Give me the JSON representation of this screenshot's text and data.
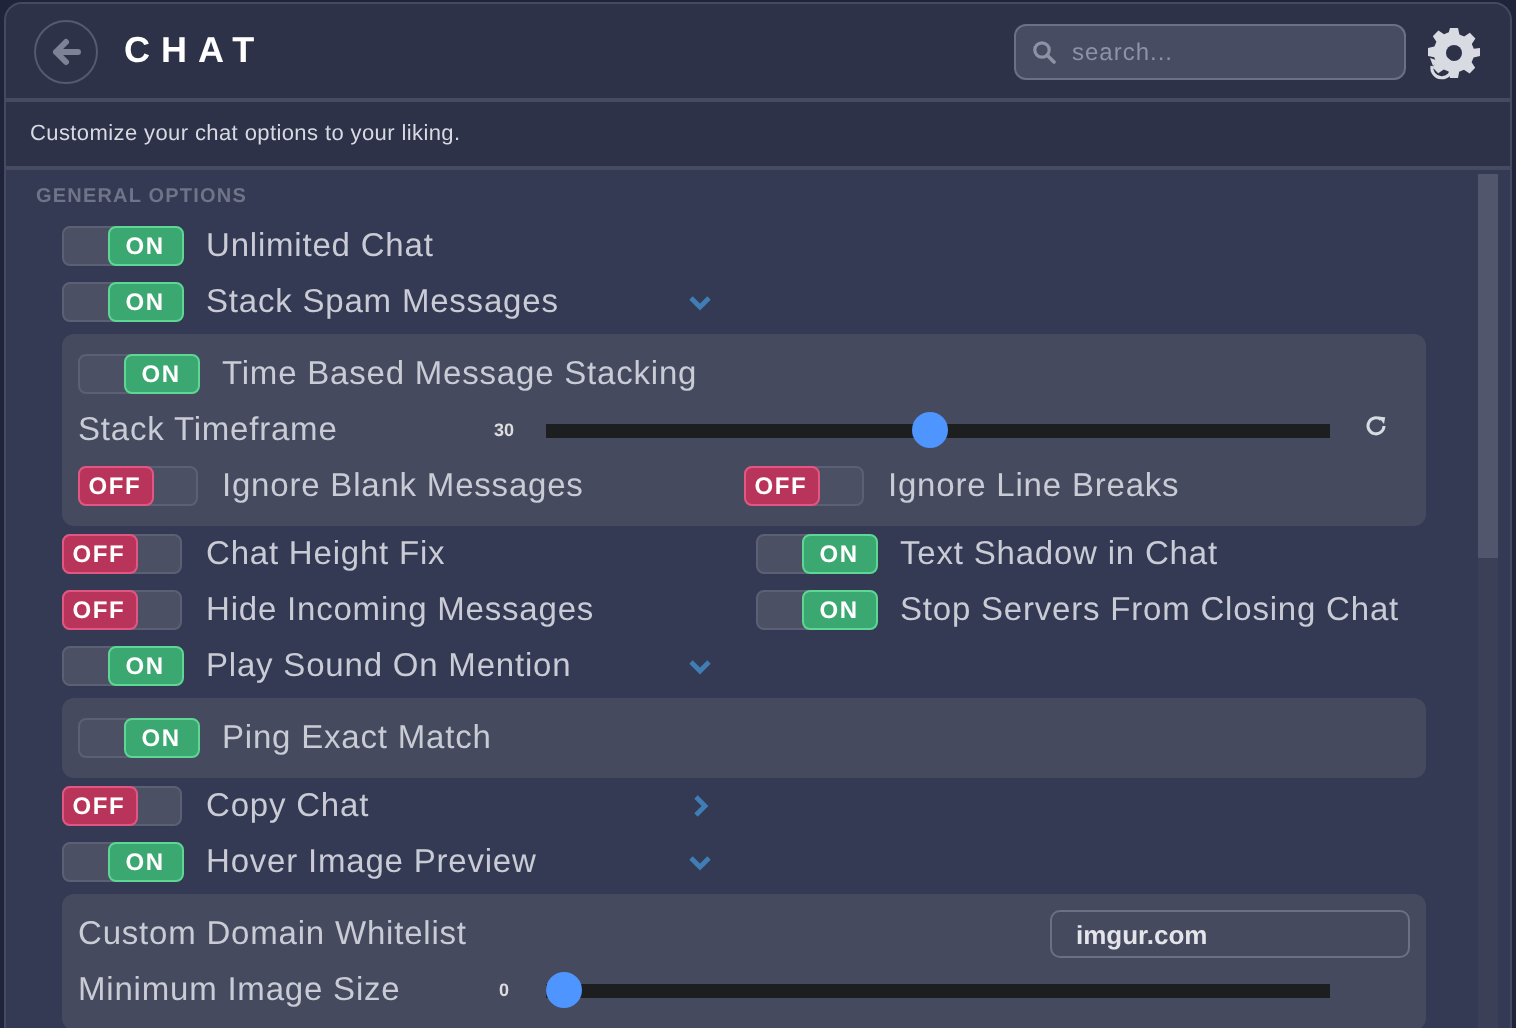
{
  "header": {
    "title": "CHAT",
    "search": {
      "placeholder": "search..."
    }
  },
  "subtitle": "Customize your chat options to your liking.",
  "section": {
    "title": "GENERAL OPTIONS",
    "items": [
      {
        "kind": "toggle",
        "label": "Unlimited Chat",
        "on": true,
        "switch_text": "ON"
      },
      {
        "kind": "toggle",
        "label": "Stack Spam Messages",
        "on": true,
        "switch_text": "ON",
        "expanded": true
      },
      {
        "kind": "group",
        "rows": [
          {
            "kind": "toggle",
            "label": "Time Based Message Stacking",
            "on": true,
            "switch_text": "ON"
          },
          {
            "kind": "slider",
            "label": "Stack Timeframe",
            "value": "30",
            "level": 0.49,
            "resettable": true
          },
          {
            "kind": "pair",
            "left": {
              "label": "Ignore Blank Messages",
              "on": false,
              "switch_text": "OFF"
            },
            "right": {
              "label": "Ignore Line Breaks",
              "on": false,
              "switch_text": "OFF"
            }
          }
        ]
      },
      {
        "kind": "pair",
        "left": {
          "label": "Chat Height Fix",
          "on": false,
          "switch_text": "OFF"
        },
        "right": {
          "label": "Text Shadow in Chat",
          "on": true,
          "switch_text": "ON"
        }
      },
      {
        "kind": "pair",
        "left": {
          "label": "Hide Incoming Messages",
          "on": false,
          "switch_text": "OFF"
        },
        "right": {
          "label": "Stop Servers From Closing Chat",
          "on": true,
          "switch_text": "ON"
        }
      },
      {
        "kind": "toggle",
        "label": "Play Sound On Mention",
        "on": true,
        "switch_text": "ON",
        "expanded": true
      },
      {
        "kind": "group",
        "rows": [
          {
            "kind": "toggle",
            "label": "Ping Exact Match",
            "on": true,
            "switch_text": "ON"
          }
        ]
      },
      {
        "kind": "toggle",
        "label": "Copy Chat",
        "on": false,
        "switch_text": "OFF",
        "expanded": false
      },
      {
        "kind": "toggle",
        "label": "Hover Image Preview",
        "on": true,
        "switch_text": "ON",
        "expanded": true
      },
      {
        "kind": "group",
        "rows": [
          {
            "kind": "text",
            "label": "Custom Domain Whitelist",
            "value": "imgur.com"
          },
          {
            "kind": "slider",
            "label": "Minimum Image Size",
            "value": "0",
            "level": 0,
            "resettable": false
          }
        ]
      }
    ]
  }
}
